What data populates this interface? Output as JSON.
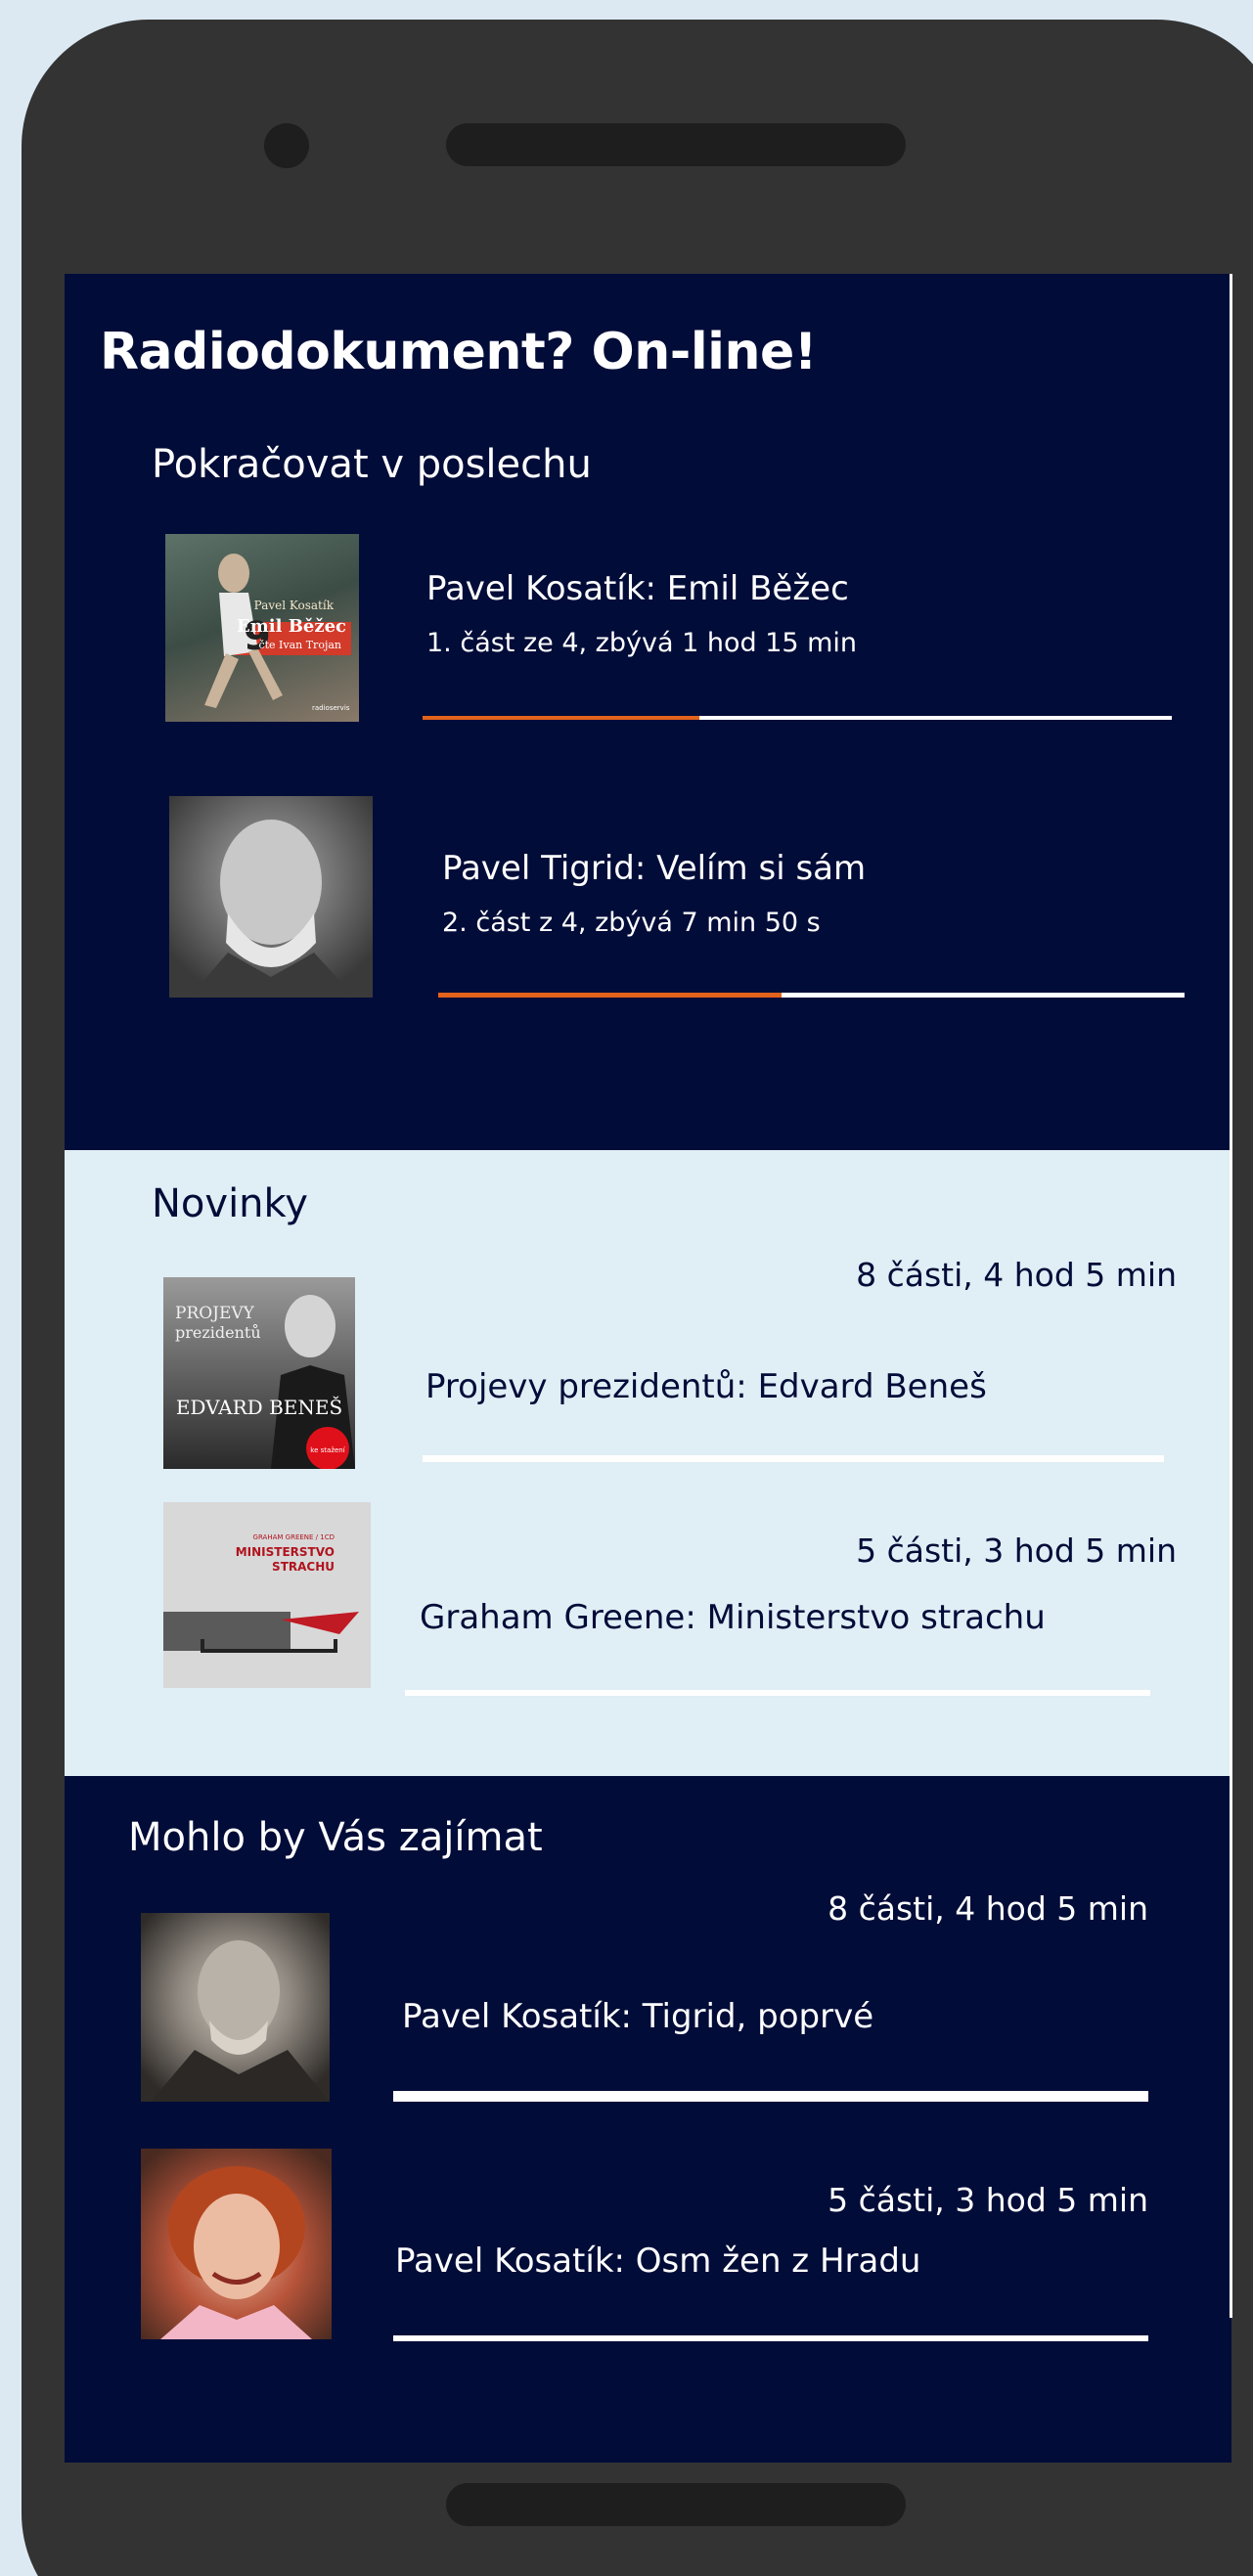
{
  "header": {
    "title": "Radiodokument? On-line!"
  },
  "continue_listening": {
    "heading": "Pokračovat v poslechu",
    "items": [
      {
        "title": "Pavel Kosatík: Emil Běžec",
        "subtitle": "1. část ze 4, zbývá 1 hod 15  min",
        "progress": 0.37,
        "cover_text": [
          "Pavel Kosatík",
          "Emil Běžec",
          "čte Ivan Trojan",
          "radioservis"
        ]
      },
      {
        "title": "Pavel Tigrid: Velím si sám",
        "subtitle": "2. část z 4, zbývá  7 min 50 s",
        "progress": 0.46
      }
    ]
  },
  "news": {
    "heading": "Novinky",
    "items": [
      {
        "meta": "8 části, 4 hod 5 min",
        "title": "Projevy prezidentů: Edvard Beneš",
        "cover_text": [
          "PROJEVY",
          "prezidentů",
          "EDVARD BENEŠ",
          "ke stažení"
        ]
      },
      {
        "meta": "5 části, 3 hod 5 min",
        "title": "Graham Greene: Ministerstvo strachu",
        "cover_text": [
          "GRAHAM GREENE / 1CD",
          "MINISTERSTVO",
          "STRACHU"
        ]
      }
    ]
  },
  "recommended": {
    "heading": "Mohlo by Vás zajímat",
    "items": [
      {
        "meta": "8 části, 4 hod 5 min",
        "title": "Pavel Kosatík: Tigrid, poprvé"
      },
      {
        "meta": "5 části, 3 hod 5 min",
        "title": "Pavel Kosatík: Osm žen z Hradu"
      }
    ]
  },
  "colors": {
    "navy": "#010c38",
    "light": "#e0eef6",
    "accent": "#e3621c",
    "phone": "#333333"
  }
}
